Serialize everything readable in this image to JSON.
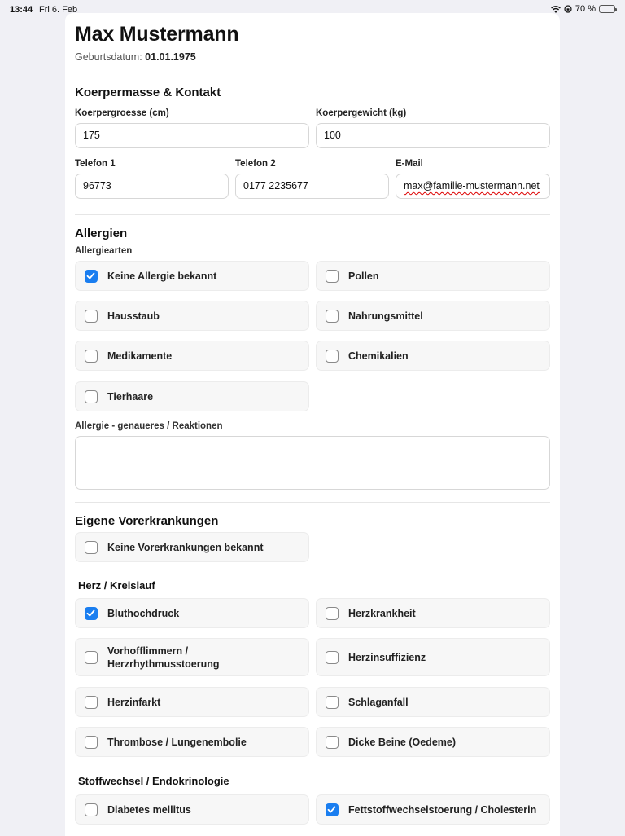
{
  "status_bar": {
    "time": "13:44",
    "date": "Fri 6. Feb",
    "battery": "70 %",
    "battery_level": 0.7
  },
  "patient": {
    "name": "Max Mustermann",
    "dob_label": "Geburtsdatum:",
    "dob_value": "01.01.1975"
  },
  "body": {
    "title": "Koerpermasse & Kontakt",
    "height_label": "Koerpergroesse (cm)",
    "height_value": "175",
    "weight_label": "Koerpergewicht (kg)",
    "weight_value": "100",
    "phone1_label": "Telefon 1",
    "phone1_value": "96773",
    "phone2_label": "Telefon 2",
    "phone2_value": "0177 2235677",
    "email_label": "E-Mail",
    "email_value": "max@familie-mustermann.net"
  },
  "allergies": {
    "title": "Allergien",
    "types_label": "Allergiearten",
    "items": [
      {
        "label": "Keine Allergie bekannt",
        "checked": true
      },
      {
        "label": "Pollen",
        "checked": false
      },
      {
        "label": "Hausstaub",
        "checked": false
      },
      {
        "label": "Nahrungsmittel",
        "checked": false
      },
      {
        "label": "Medikamente",
        "checked": false
      },
      {
        "label": "Chemikalien",
        "checked": false
      },
      {
        "label": "Tierhaare",
        "checked": false
      }
    ],
    "details_label": "Allergie - genaueres / Reaktionen",
    "details_value": ""
  },
  "conditions": {
    "title": "Eigene Vorerkrankungen",
    "none": {
      "label": "Keine Vorerkrankungen bekannt",
      "checked": false
    },
    "cardio_title": "Herz / Kreislauf",
    "cardio": [
      {
        "label": "Bluthochdruck",
        "checked": true
      },
      {
        "label": "Herzkrankheit",
        "checked": false
      },
      {
        "label": "Vorhofflimmern / Herzrhythmusstoerung",
        "checked": false
      },
      {
        "label": "Herzinsuffizienz",
        "checked": false
      },
      {
        "label": "Herzinfarkt",
        "checked": false
      },
      {
        "label": "Schlaganfall",
        "checked": false
      },
      {
        "label": "Thrombose / Lungenembolie",
        "checked": false
      },
      {
        "label": "Dicke Beine (Oedeme)",
        "checked": false
      }
    ],
    "metabolic_title": "Stoffwechsel / Endokrinologie",
    "metabolic": [
      {
        "label": "Diabetes mellitus",
        "checked": false
      },
      {
        "label": "Fettstoffwechselstoerung / Cholesterin",
        "checked": true
      }
    ]
  },
  "colors": {
    "accent": "#1a7ef0",
    "background": "#f0f0f5"
  }
}
